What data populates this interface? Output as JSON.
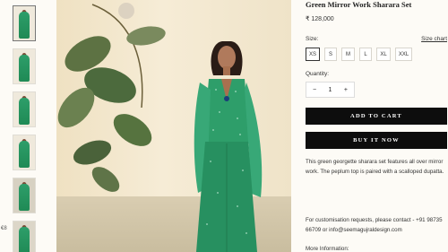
{
  "product": {
    "title": "Green Mirror Work Sharara Set",
    "price": "₹ 128,000",
    "size_label": "Size:",
    "size_chart": "Size chart",
    "sizes": [
      "XS",
      "S",
      "M",
      "L",
      "XL",
      "XXL"
    ],
    "selected_size": "XS",
    "quantity_label": "Quantity:",
    "quantity": "1",
    "minus": "−",
    "plus": "+",
    "add_to_cart": "ADD TO CART",
    "buy_now": "BUY IT NOW",
    "description": "This green georgette sharara set features all over mirror work. The peplum top is paired with a scalloped dupatta.",
    "contact": "For customisation requests, please contact - +91 98735 66709 or info@seemagujraldesign.com",
    "more_info": "More Information:"
  },
  "gallery": {
    "thumbnail_count": 6,
    "active_index": 0,
    "rotate_label": "€8"
  },
  "colors": {
    "outfit_green": "#2e9e6a",
    "button_dark": "#0d0d0d",
    "background": "#fdfbf6"
  }
}
